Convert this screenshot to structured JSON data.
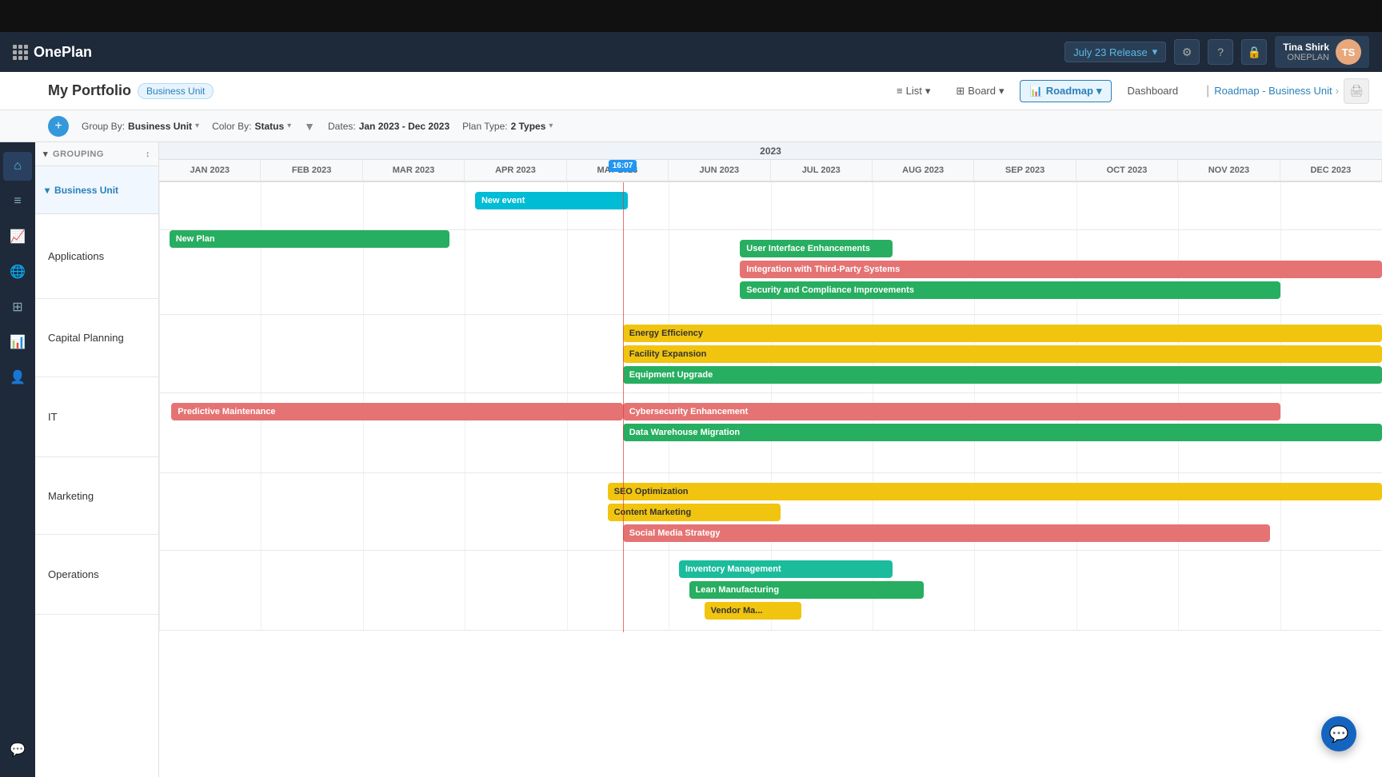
{
  "topBar": {},
  "header": {
    "appName": "OnePlan",
    "release": "July 23 Release",
    "user": {
      "name": "Tina Shirk",
      "org": "ONEPLAN",
      "initials": "TS"
    }
  },
  "subHeader": {
    "portfolioTitle": "My Portfolio",
    "businessUnitBadge": "Business Unit",
    "viewButtons": [
      "List",
      "Board",
      "Roadmap",
      "Dashboard"
    ],
    "activeView": "Roadmap",
    "roadmapLink": "Roadmap - Business Unit"
  },
  "toolbar": {
    "groupBy": "Business Unit",
    "colorBy": "Status",
    "dates": "Jan 2023 - Dec 2023",
    "planType": "2 Types"
  },
  "timeline": {
    "year": "2023",
    "months": [
      "JAN 2023",
      "FEB 2023",
      "MAR 2023",
      "APR 2023",
      "MAY 2023",
      "JUN 2023",
      "JUL 2023",
      "AUG 2023",
      "SEP 2023",
      "OCT 2023",
      "NOV 2023",
      "DEC 2023"
    ],
    "todayMarker": "16:07",
    "todayCol": 4.55
  },
  "sidebar": {
    "icons": [
      "home",
      "list",
      "chart",
      "globe",
      "puzzle",
      "analytics",
      "user",
      "message"
    ]
  },
  "groups": [
    {
      "id": "business-unit",
      "label": "Business Unit",
      "isParent": true
    },
    {
      "id": "applications",
      "label": "Applications"
    },
    {
      "id": "capital-planning",
      "label": "Capital Planning"
    },
    {
      "id": "it",
      "label": "IT"
    },
    {
      "id": "marketing",
      "label": "Marketing"
    },
    {
      "id": "operations",
      "label": "Operations"
    }
  ],
  "bars": {
    "newEvent": {
      "label": "New event",
      "color": "cyan",
      "colStart": 3.1,
      "colEnd": 4.6,
      "rowTop": 12
    },
    "newPlan": {
      "label": "New Plan",
      "color": "green",
      "colStart": 0.1,
      "colEnd": 2.85,
      "rowTop": 60
    },
    "uiEnhancements": {
      "label": "User Interface Enhancements",
      "color": "green",
      "colStart": 5.7,
      "colEnd": 7.2,
      "rowTop": 12
    },
    "integration": {
      "label": "Integration with Third-Party Systems",
      "color": "salmon",
      "colStart": 5.7,
      "colEnd": 12,
      "rowTop": 38
    },
    "security": {
      "label": "Security and Compliance Improvements",
      "color": "green",
      "colStart": 5.7,
      "colEnd": 11.0,
      "rowTop": 64
    },
    "energyEfficiency": {
      "label": "Energy Efficiency",
      "color": "yellow",
      "colStart": 4.55,
      "colEnd": 12,
      "rowTop": 12
    },
    "facilityExpansion": {
      "label": "Facility Expansion",
      "color": "yellow",
      "colStart": 4.55,
      "colEnd": 12,
      "rowTop": 38
    },
    "equipmentUpgrade": {
      "label": "Equipment Upgrade",
      "color": "green",
      "colStart": 4.55,
      "colEnd": 12,
      "rowTop": 64
    },
    "predictiveMaintenance": {
      "label": "Predictive Maintenance",
      "color": "salmon",
      "colStart": 0.12,
      "colEnd": 4.55,
      "rowTop": 12
    },
    "cybersecurity": {
      "label": "Cybersecurity Enhancement",
      "color": "salmon",
      "colStart": 4.55,
      "colEnd": 11.0,
      "rowTop": 12
    },
    "dataWarehouse": {
      "label": "Data Warehouse Migration",
      "color": "green",
      "colStart": 4.55,
      "colEnd": 12,
      "rowTop": 38
    },
    "seoOptimization": {
      "label": "SEO Optimization",
      "color": "yellow",
      "colStart": 4.4,
      "colEnd": 12,
      "rowTop": 12
    },
    "contentMarketing": {
      "label": "Content Marketing",
      "color": "yellow",
      "colStart": 4.4,
      "colEnd": 6.1,
      "rowTop": 38
    },
    "socialMedia": {
      "label": "Social Media Strategy",
      "color": "salmon",
      "colStart": 4.55,
      "colEnd": 10.9,
      "rowTop": 64
    },
    "inventoryMgmt": {
      "label": "Inventory Management",
      "color": "teal",
      "colStart": 5.1,
      "colEnd": 7.2,
      "rowTop": 12
    },
    "leanManufacturing": {
      "label": "Lean Manufacturing",
      "color": "green",
      "colStart": 5.2,
      "colEnd": 7.5,
      "rowTop": 38
    },
    "vendorMgmt": {
      "label": "Vendor Ma...",
      "color": "yellow",
      "colStart": 5.35,
      "colEnd": 6.3,
      "rowTop": 64
    }
  }
}
